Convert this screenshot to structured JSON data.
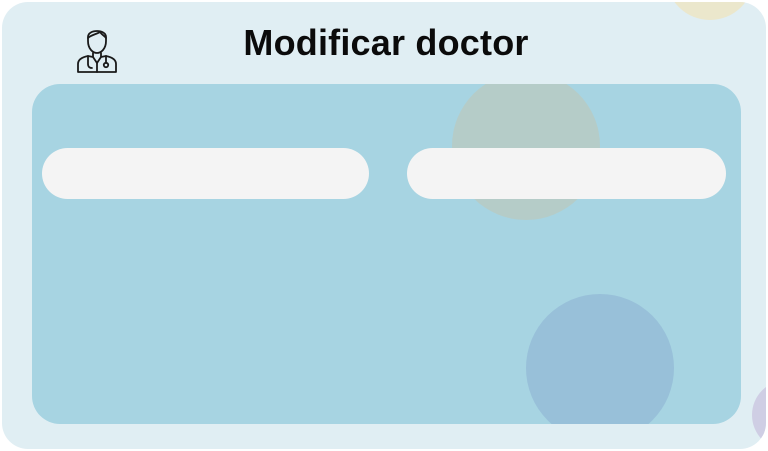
{
  "header": {
    "title": "Modificar doctor",
    "icon": "doctor-icon"
  },
  "form": {
    "field_left": {
      "value": "",
      "placeholder": ""
    },
    "field_right": {
      "value": "",
      "placeholder": ""
    }
  },
  "colors": {
    "window_bg": "#e0eef3",
    "panel_bg": "#a7d4e2",
    "field_bg": "#f4f4f4",
    "title_text": "#0b0b0b"
  }
}
